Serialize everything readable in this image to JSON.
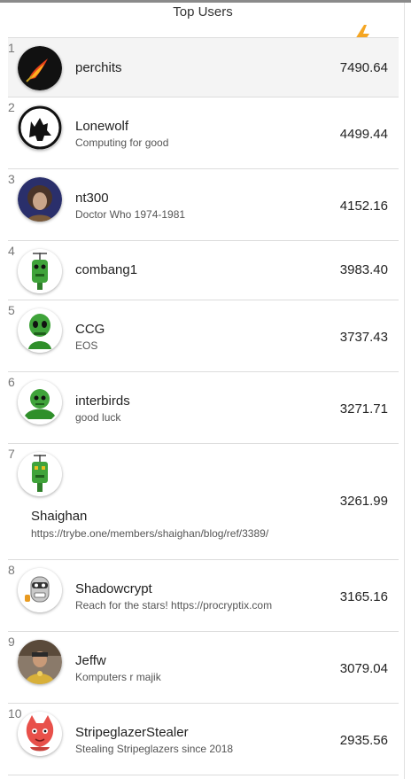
{
  "header": {
    "title": "Top Users"
  },
  "column_icon": "lightning-bolt-icon",
  "accent": "#f5a623",
  "users": [
    {
      "rank": "1",
      "name": "perchits",
      "tagline": "",
      "score": "7490.64",
      "avatar": "flame-avatar-icon"
    },
    {
      "rank": "2",
      "name": "Lonewolf",
      "tagline": "Computing for good",
      "score": "4499.44",
      "avatar": "wolf-avatar-icon"
    },
    {
      "rank": "3",
      "name": "nt300",
      "tagline": "Doctor Who 1974-1981",
      "score": "4152.16",
      "avatar": "portrait-avatar-icon"
    },
    {
      "rank": "4",
      "name": "combang1",
      "tagline": "",
      "score": "3983.40",
      "avatar": "robot-avatar-icon"
    },
    {
      "rank": "5",
      "name": "CCG",
      "tagline": "EOS",
      "score": "3737.43",
      "avatar": "alien-avatar-icon"
    },
    {
      "rank": "6",
      "name": "interbirds",
      "tagline": "good luck",
      "score": "3271.71",
      "avatar": "robot-avatar-icon"
    },
    {
      "rank": "7",
      "name": "Shaighan",
      "tagline": "https://trybe.one/members/shaighan/blog/ref/3389/",
      "score": "3261.99",
      "avatar": "robot-avatar-icon"
    },
    {
      "rank": "8",
      "name": "Shadowcrypt",
      "tagline": "Reach for the stars! https://procryptix.com",
      "score": "3165.16",
      "avatar": "robot-avatar-icon"
    },
    {
      "rank": "9",
      "name": "Jeffw",
      "tagline": "Komputers r majik",
      "score": "3079.04",
      "avatar": "photo-avatar-icon"
    },
    {
      "rank": "10",
      "name": "StripeglazerStealer",
      "tagline": "Stealing Stripeglazers since 2018",
      "score": "2935.56",
      "avatar": "cat-avatar-icon"
    }
  ]
}
